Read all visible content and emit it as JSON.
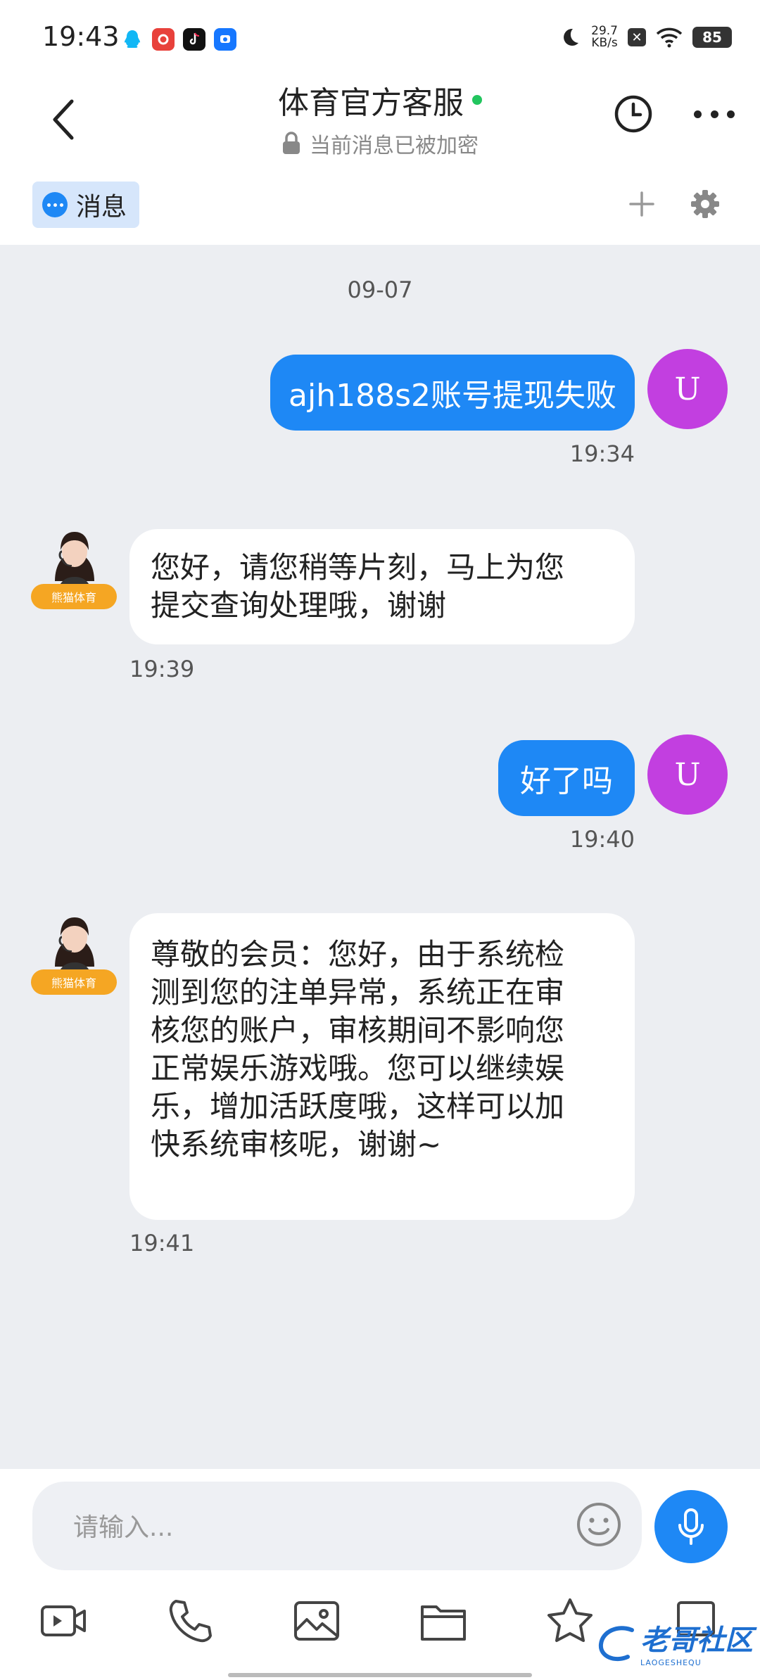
{
  "status_bar": {
    "time": "19:43",
    "net_speed_value": "29.7",
    "net_speed_unit": "KB/s",
    "battery": "85"
  },
  "header": {
    "title": "体育官方客服",
    "subtitle": "当前消息已被加密"
  },
  "tabs": {
    "messages_label": "消息"
  },
  "chat": {
    "date": "09-07",
    "user_avatar_letter": "U",
    "agent_badge": "熊猫体育",
    "messages": [
      {
        "from": "user",
        "text": "ajh188s2账号提现失败",
        "time": "19:34"
      },
      {
        "from": "agent",
        "lines": [
          "您好，请您稍等片刻，马上为您",
          "提交查询处理哦，谢谢"
        ],
        "time": "19:39"
      },
      {
        "from": "user",
        "text": "好了吗",
        "time": "19:40"
      },
      {
        "from": "agent",
        "lines": [
          "尊敬的会员：您好，由于系统检",
          "测到您的注单异常，系统正在审",
          "核您的账户，审核期间不影响您",
          "正常娱乐游戏哦。您可以继续娱",
          "乐，增加活跃度哦，这样可以加",
          "快系统审核呢，谢谢~"
        ],
        "time": "19:41"
      }
    ]
  },
  "input": {
    "placeholder": "请输入..."
  },
  "watermark": {
    "main": "老哥社区",
    "sub": "LAOGESHEQU"
  },
  "colors": {
    "accent": "#1e88f5",
    "user_avatar": "#c23fe0",
    "badge": "#f5a623",
    "background": "#eceef2"
  }
}
